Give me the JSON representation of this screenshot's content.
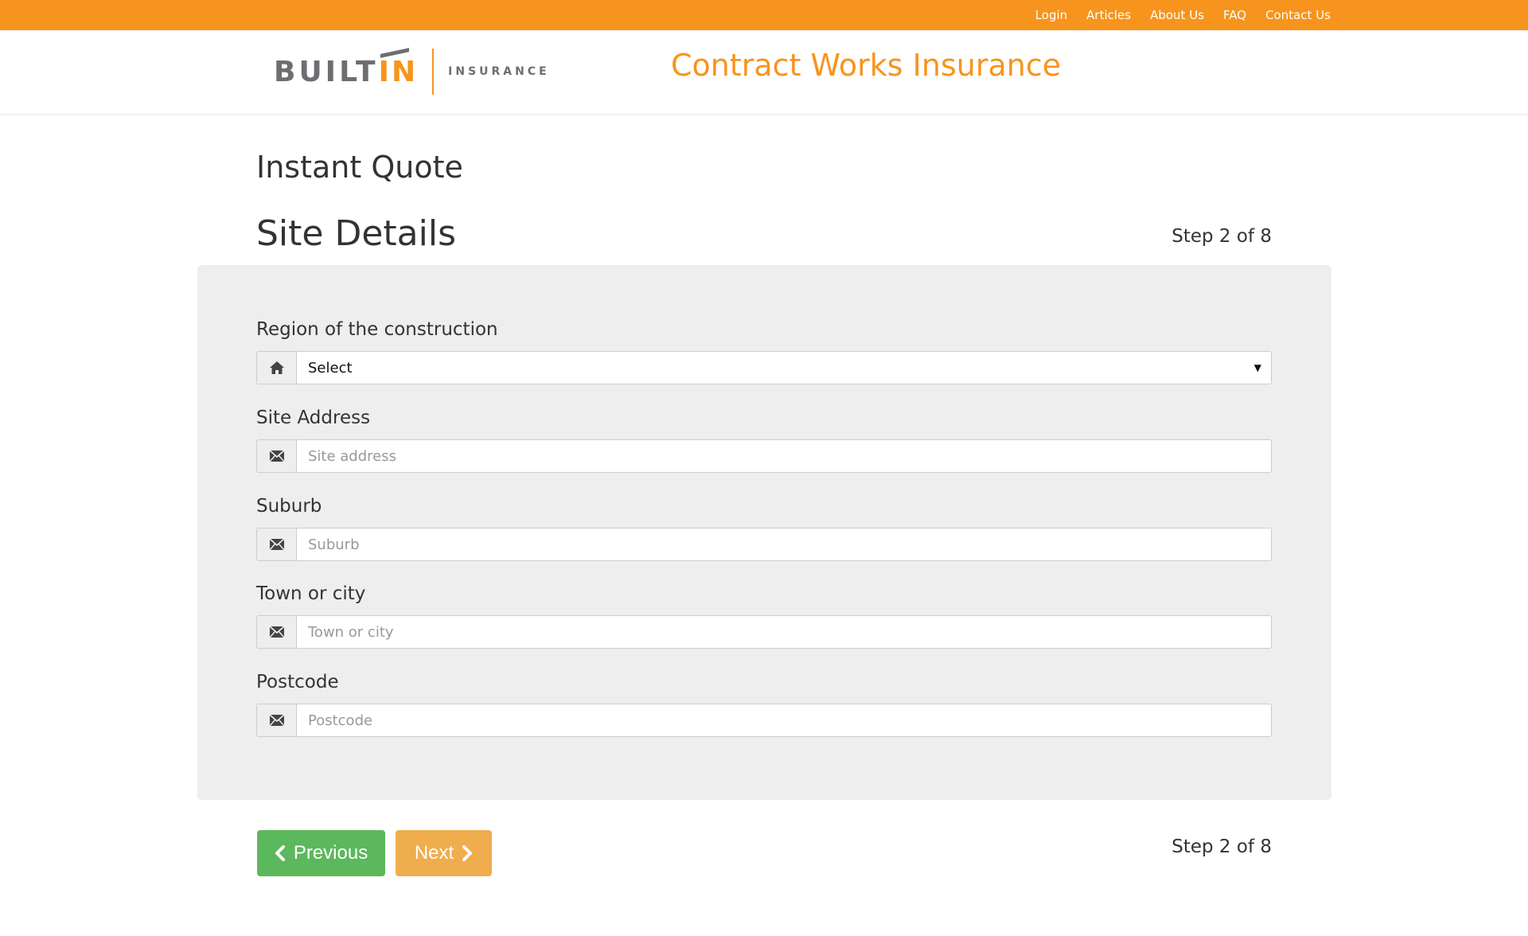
{
  "topnav": {
    "items": [
      {
        "label": "Login"
      },
      {
        "label": "Articles"
      },
      {
        "label": "About Us"
      },
      {
        "label": "FAQ"
      },
      {
        "label": "Contact Us"
      }
    ]
  },
  "header": {
    "logo_built": "BUILT",
    "logo_in": "IN",
    "logo_insurance": "INSURANCE",
    "site_title": "Contract Works Insurance"
  },
  "page": {
    "heading": "Instant Quote",
    "section": "Site Details",
    "step": "Step 2 of 8"
  },
  "form": {
    "region": {
      "label": "Region of the construction",
      "value": "Select",
      "icon": "home-icon"
    },
    "address": {
      "label": "Site Address",
      "placeholder": "Site address",
      "icon": "envelope-icon"
    },
    "suburb": {
      "label": "Suburb",
      "placeholder": "Suburb",
      "icon": "envelope-icon"
    },
    "town": {
      "label": "Town or city",
      "placeholder": "Town or city",
      "icon": "envelope-icon"
    },
    "postcode": {
      "label": "Postcode",
      "placeholder": "Postcode",
      "icon": "envelope-icon"
    }
  },
  "buttons": {
    "previous": "Previous",
    "next": "Next"
  },
  "colors": {
    "brand_orange": "#f7941d",
    "previous_green": "#5cb85c",
    "next_orange": "#f0ad4e",
    "panel_gray": "#eeeeee"
  }
}
